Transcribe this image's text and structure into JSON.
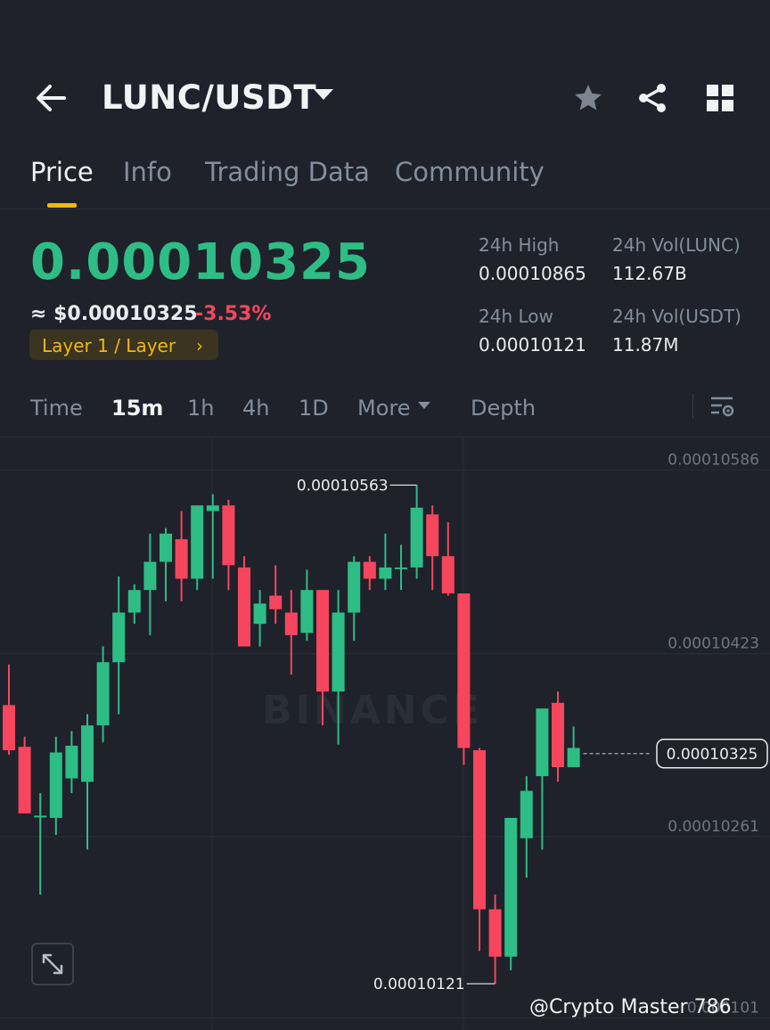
{
  "header": {
    "pair": "LUNC/USDT",
    "icons": [
      "back-arrow-icon",
      "chevron-down-icon",
      "star-icon",
      "share-icon",
      "grid-icon"
    ]
  },
  "tabs": [
    {
      "label": "Price",
      "active": true
    },
    {
      "label": "Info",
      "active": false
    },
    {
      "label": "Trading Data",
      "active": false
    },
    {
      "label": "Community",
      "active": false
    }
  ],
  "ticker": {
    "last_price": "0.00010325",
    "fiat_price": "≈ $0.00010325",
    "change_pct": "-3.53%",
    "tag": "Layer 1 / Layer",
    "tag_chevron": "›",
    "stats": {
      "high_label": "24h High",
      "high_value": "0.00010865",
      "vol_base_label": "24h Vol(LUNC)",
      "vol_base_value": "112.67B",
      "low_label": "24h Low",
      "low_value": "0.00010121",
      "vol_quote_label": "24h Vol(USDT)",
      "vol_quote_value": "11.87M"
    }
  },
  "intervals": [
    {
      "label": "Time",
      "active": false
    },
    {
      "label": "15m",
      "active": true
    },
    {
      "label": "1h",
      "active": false
    },
    {
      "label": "4h",
      "active": false
    },
    {
      "label": "1D",
      "active": false
    },
    {
      "label": "More",
      "active": false
    },
    {
      "label": "Depth",
      "active": false
    }
  ],
  "colors": {
    "up": "#2ebd85",
    "down": "#f6465d",
    "accent": "#f0b90b",
    "background": "#1f222b",
    "muted": "#848e9c"
  },
  "watermark": "BINANCE",
  "credit": "@Crypto Master 786",
  "chart_data": {
    "type": "candlestick",
    "y_ticks": [
      "0.00010586",
      "0.00010423",
      "0.00010261",
      "0.000101"
    ],
    "ylim": [
      0.0001008,
      0.00010606
    ],
    "current_price_label": "0.00010325",
    "current_price": 0.00010325,
    "max_marker": {
      "label": "0.00010563",
      "value": 0.00010563,
      "index": 26
    },
    "min_marker": {
      "label": "0.00010121",
      "value": 0.00010121,
      "index": 31
    },
    "candles": [
      {
        "o": 0.00010368,
        "h": 0.00010404,
        "l": 0.00010324,
        "c": 0.00010328
      },
      {
        "o": 0.00010331,
        "h": 0.0001034,
        "l": 0.00010285,
        "c": 0.00010272
      },
      {
        "o": 0.0001027,
        "h": 0.0001029,
        "l": 0.000102,
        "c": 0.0001027
      },
      {
        "o": 0.00010268,
        "h": 0.0001034,
        "l": 0.00010253,
        "c": 0.00010326
      },
      {
        "o": 0.00010303,
        "h": 0.00010345,
        "l": 0.0001029,
        "c": 0.00010332
      },
      {
        "o": 0.000103,
        "h": 0.0001036,
        "l": 0.0001024,
        "c": 0.0001035
      },
      {
        "o": 0.0001035,
        "h": 0.0001042,
        "l": 0.00010335,
        "c": 0.00010406
      },
      {
        "o": 0.00010406,
        "h": 0.00010482,
        "l": 0.0001036,
        "c": 0.0001045
      },
      {
        "o": 0.0001045,
        "h": 0.00010475,
        "l": 0.0001044,
        "c": 0.0001047
      },
      {
        "o": 0.0001047,
        "h": 0.0001052,
        "l": 0.0001043,
        "c": 0.00010495
      },
      {
        "o": 0.00010495,
        "h": 0.00010525,
        "l": 0.0001046,
        "c": 0.0001052
      },
      {
        "o": 0.00010515,
        "h": 0.0001054,
        "l": 0.0001046,
        "c": 0.0001048
      },
      {
        "o": 0.0001048,
        "h": 0.00010545,
        "l": 0.0001047,
        "c": 0.00010545
      },
      {
        "o": 0.0001054,
        "h": 0.00010555,
        "l": 0.0001048,
        "c": 0.00010545
      },
      {
        "o": 0.00010545,
        "h": 0.0001055,
        "l": 0.0001047,
        "c": 0.00010492
      },
      {
        "o": 0.0001049,
        "h": 0.000105,
        "l": 0.0001042,
        "c": 0.0001042
      },
      {
        "o": 0.0001044,
        "h": 0.0001047,
        "l": 0.0001042,
        "c": 0.00010458
      },
      {
        "o": 0.00010465,
        "h": 0.00010492,
        "l": 0.0001044,
        "c": 0.00010453
      },
      {
        "o": 0.0001045,
        "h": 0.0001047,
        "l": 0.00010395,
        "c": 0.0001043
      },
      {
        "o": 0.00010432,
        "h": 0.00010488,
        "l": 0.00010425,
        "c": 0.0001047
      },
      {
        "o": 0.0001047,
        "h": 0.0001047,
        "l": 0.0001035,
        "c": 0.0001038
      },
      {
        "o": 0.0001038,
        "h": 0.0001047,
        "l": 0.00010333,
        "c": 0.0001045
      },
      {
        "o": 0.0001045,
        "h": 0.000105,
        "l": 0.00010425,
        "c": 0.00010495
      },
      {
        "o": 0.00010495,
        "h": 0.000105,
        "l": 0.0001047,
        "c": 0.0001048
      },
      {
        "o": 0.0001048,
        "h": 0.0001052,
        "l": 0.0001047,
        "c": 0.0001049
      },
      {
        "o": 0.0001049,
        "h": 0.0001051,
        "l": 0.0001047,
        "c": 0.0001049
      },
      {
        "o": 0.0001049,
        "h": 0.00010563,
        "l": 0.0001048,
        "c": 0.00010543
      },
      {
        "o": 0.00010537,
        "h": 0.00010545,
        "l": 0.0001047,
        "c": 0.000105
      },
      {
        "o": 0.000105,
        "h": 0.0001053,
        "l": 0.00010465,
        "c": 0.00010467
      },
      {
        "o": 0.00010467,
        "h": 0.00010467,
        "l": 0.00010315,
        "c": 0.0001033
      },
      {
        "o": 0.00010328,
        "h": 0.0001033,
        "l": 0.0001015,
        "c": 0.00010187
      },
      {
        "o": 0.00010187,
        "h": 0.000102,
        "l": 0.00010121,
        "c": 0.00010145
      },
      {
        "o": 0.00010145,
        "h": 0.00010268,
        "l": 0.00010133,
        "c": 0.00010268
      },
      {
        "o": 0.0001025,
        "h": 0.00010305,
        "l": 0.00010215,
        "c": 0.00010292
      },
      {
        "o": 0.00010305,
        "h": 0.0001036,
        "l": 0.0001024,
        "c": 0.00010365
      },
      {
        "o": 0.0001037,
        "h": 0.0001038,
        "l": 0.000103,
        "c": 0.00010313
      },
      {
        "o": 0.00010313,
        "h": 0.00010349,
        "l": 0.00010313,
        "c": 0.0001033
      }
    ]
  }
}
